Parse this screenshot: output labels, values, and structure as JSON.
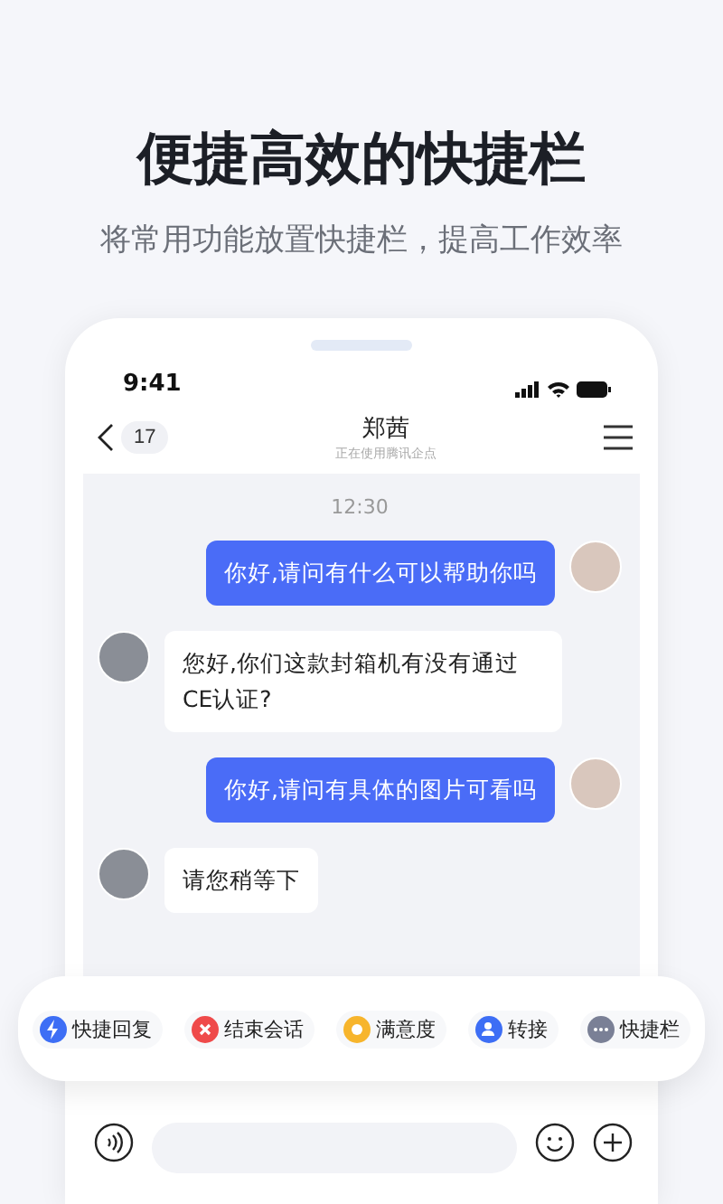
{
  "headline": "便捷高效的快捷栏",
  "subtitle": "将常用功能放置快捷栏，提高工作效率",
  "status_bar": {
    "time": "9:41"
  },
  "chat_header": {
    "back_count": "17",
    "name": "郑茜",
    "status": "正在使用腾讯企点"
  },
  "timestamp": "12:30",
  "messages": [
    {
      "kind": "sent",
      "text": "你好,请问有什么可以帮助你吗"
    },
    {
      "kind": "received",
      "text": "您好,你们这款封箱机有没有通过CE认证?"
    },
    {
      "kind": "sent",
      "text": "你好,请问有具体的图片可看吗"
    },
    {
      "kind": "received",
      "text": "请您稍等下"
    }
  ],
  "quick_bar": [
    {
      "kind": "bolt",
      "label": "快捷回复",
      "color": "#3d6ef5"
    },
    {
      "kind": "close",
      "label": "结束会话",
      "color": "#ef4a4a"
    },
    {
      "kind": "star",
      "label": "满意度",
      "color": "#f7b52c"
    },
    {
      "kind": "person",
      "label": "转接",
      "color": "#3d6ef5"
    },
    {
      "kind": "more",
      "label": "快捷栏",
      "color": "#7a8096"
    }
  ]
}
